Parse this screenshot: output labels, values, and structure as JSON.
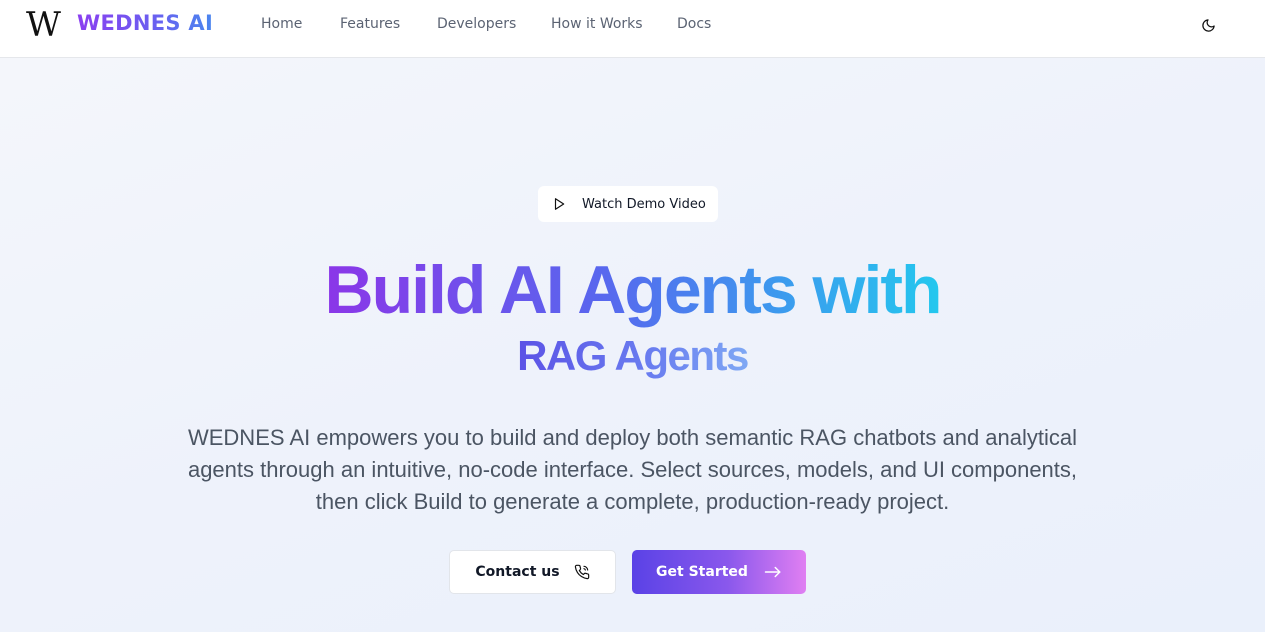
{
  "brand": {
    "logo_mark": "W",
    "name": "WEDNES AI"
  },
  "nav": {
    "items": [
      {
        "label": "Home"
      },
      {
        "label": "Features"
      },
      {
        "label": "Developers"
      },
      {
        "label": "How it Works"
      },
      {
        "label": "Docs"
      }
    ],
    "theme_toggle_icon": "moon-icon"
  },
  "hero": {
    "demo_button": {
      "label": "Watch Demo Video",
      "icon": "play-icon"
    },
    "headline": "Build AI Agents with",
    "subheadline": "RAG Agents",
    "description": "WEDNES AI empowers you to build and deploy both semantic RAG chatbots and analytical agents through an intuitive, no-code interface. Select sources, models, and UI components, then click Build to generate a complete, production-ready project.",
    "contact_button": {
      "label": "Contact us",
      "icon": "phone-icon"
    },
    "start_button": {
      "label": "Get Started",
      "icon": "arrow-right-icon"
    }
  },
  "colors": {
    "brand_purple": "#8b3ff0",
    "brand_blue": "#4a86ef",
    "headline_cyan": "#23c8ee",
    "button_gradient_start": "#5a42e6",
    "button_gradient_end": "#e07ff2"
  }
}
